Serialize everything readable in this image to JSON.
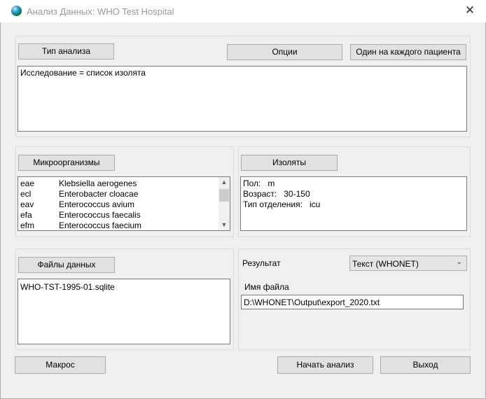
{
  "window": {
    "title": "Анализ Данных: WHO Test Hospital",
    "close_glyph": "✕"
  },
  "analysis": {
    "type_button": "Тип анализа",
    "options_button": "Опции",
    "per_patient_button": "Один на каждого пациента",
    "description": "Исследование = список изолята"
  },
  "organisms": {
    "button": "Микроорганизмы",
    "items": [
      {
        "code": "eae",
        "name": "Klebsiella aerogenes"
      },
      {
        "code": "ecl",
        "name": "Enterobacter cloacae"
      },
      {
        "code": "eav",
        "name": "Enterococcus avium"
      },
      {
        "code": "efa",
        "name": "Enterococcus faecalis"
      },
      {
        "code": "efm",
        "name": "Enterococcus faecium"
      }
    ]
  },
  "isolates": {
    "button": "Изоляты",
    "lines": [
      {
        "label": "Пол:",
        "value": "m"
      },
      {
        "label": "Возраст:",
        "value": "30-150"
      },
      {
        "label": "Тип отделения:",
        "value": "icu"
      }
    ]
  },
  "data_files": {
    "button": "Файлы данных",
    "files": [
      "WHO-TST-1995-01.sqlite"
    ]
  },
  "output": {
    "result_label": "Результат",
    "result_value": "Текст (WHONET)",
    "filename_label": "Имя файла",
    "filename_value": "D:\\WHONET\\Output\\export_2020.txt"
  },
  "footer": {
    "macros_button": "Макрос",
    "start_button": "Начать анализ",
    "exit_button": "Выход"
  }
}
